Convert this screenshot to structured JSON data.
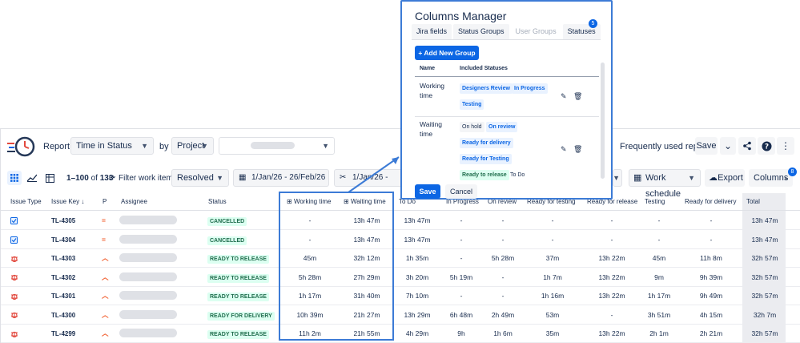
{
  "toolbar": {
    "report_label": "Report:",
    "report_value": "Time in Status",
    "by_label": "by",
    "by_value": "Project",
    "frequently_used": "Frequently used report",
    "save_label": "Save"
  },
  "filters": {
    "range": "1–100",
    "of": "of",
    "total": "133",
    "filter_label": "Filter work items:",
    "filter_value": "Resolved",
    "date1": "1/Jan/26 - 26/Feb/26",
    "date2": "1/Jan/26 - 26/Feb/26",
    "work_schedule": "Work schedule",
    "export": "Export",
    "columns": "Columns",
    "columns_badge": "8"
  },
  "table": {
    "headers": {
      "issue_type": "Issue Type",
      "issue_key": "Issue Key",
      "p": "P",
      "assignee": "Assignee",
      "status": "Status",
      "working_time": "Working time",
      "waiting_time": "Waiting time",
      "todo": "To Do",
      "in_progress": "In Progress",
      "on_review": "On review",
      "ready_for_testing": "Ready for testing",
      "ready_for_release": "Ready for release",
      "testing": "Testing",
      "ready_for_delivery": "Ready for delivery",
      "total": "Total"
    },
    "rows": [
      {
        "key": "TL-4305",
        "type": "task",
        "priority": "medium",
        "status": "CANCELLED",
        "working": "-",
        "waiting": "13h 47m",
        "todo": "13h 47m",
        "inprog": "-",
        "review": "-",
        "rft": "-",
        "rfr": "-",
        "testing": "-",
        "rfd": "-",
        "total": "13h 47m"
      },
      {
        "key": "TL-4304",
        "type": "task",
        "priority": "medium",
        "status": "CANCELLED",
        "working": "-",
        "waiting": "13h 47m",
        "todo": "13h 47m",
        "inprog": "-",
        "review": "-",
        "rft": "-",
        "rfr": "-",
        "testing": "-",
        "rfd": "-",
        "total": "13h 47m"
      },
      {
        "key": "TL-4303",
        "type": "bug",
        "priority": "high",
        "status": "READY TO RELEASE",
        "working": "45m",
        "waiting": "32h 12m",
        "todo": "1h 35m",
        "inprog": "-",
        "review": "5h 28m",
        "rft": "37m",
        "rfr": "13h 22m",
        "testing": "45m",
        "rfd": "11h 8m",
        "total": "32h 57m"
      },
      {
        "key": "TL-4302",
        "type": "bug",
        "priority": "high",
        "status": "READY TO RELEASE",
        "working": "5h 28m",
        "waiting": "27h 29m",
        "todo": "3h 20m",
        "inprog": "5h 19m",
        "review": "-",
        "rft": "1h 7m",
        "rfr": "13h 22m",
        "testing": "9m",
        "rfd": "9h 39m",
        "total": "32h 57m"
      },
      {
        "key": "TL-4301",
        "type": "bug",
        "priority": "high",
        "status": "READY TO RELEASE",
        "working": "1h 17m",
        "waiting": "31h 40m",
        "todo": "7h 10m",
        "inprog": "-",
        "review": "-",
        "rft": "1h 16m",
        "rfr": "13h 22m",
        "testing": "1h 17m",
        "rfd": "9h 49m",
        "total": "32h 57m"
      },
      {
        "key": "TL-4300",
        "type": "bug",
        "priority": "high",
        "status": "READY FOR DELIVERY",
        "working": "10h 39m",
        "waiting": "21h 27m",
        "todo": "13h 29m",
        "inprog": "6h 48m",
        "review": "2h 49m",
        "rft": "53m",
        "rfr": "-",
        "testing": "3h 51m",
        "rfd": "4h 15m",
        "total": "32h 7m"
      },
      {
        "key": "TL-4299",
        "type": "bug",
        "priority": "high",
        "status": "READY TO RELEASE",
        "working": "11h 2m",
        "waiting": "21h 55m",
        "todo": "4h 29m",
        "inprog": "9h",
        "review": "1h 6m",
        "rft": "35m",
        "rfr": "13h 22m",
        "testing": "2h 1m",
        "rfd": "2h 21m",
        "total": "32h 57m"
      }
    ]
  },
  "modal": {
    "title": "Columns Manager",
    "tabs": [
      "Jira fields",
      "Status Groups",
      "User Groups",
      "Statuses"
    ],
    "statuses_badge": "5",
    "add_group": "+ Add New Group",
    "col_name": "Name",
    "col_included": "Included Statuses",
    "groups": [
      {
        "name": "Working time",
        "statuses": [
          "Designers Review",
          "In Progress",
          "Testing"
        ]
      },
      {
        "name": "Waiting time",
        "statuses": [
          "On hold",
          "On review",
          "Ready for delivery",
          "Ready for Testing",
          "Ready to release",
          "To Do"
        ]
      }
    ],
    "save": "Save",
    "cancel": "Cancel"
  },
  "colors": {
    "accent": "#0c66e4",
    "highlight_border": "#3c7bd6",
    "lozenge_green_bg": "#dcfff1",
    "lozenge_green_text": "#216e4e",
    "bug_red": "#e2483d",
    "priority_orange": "#f15b2a"
  }
}
